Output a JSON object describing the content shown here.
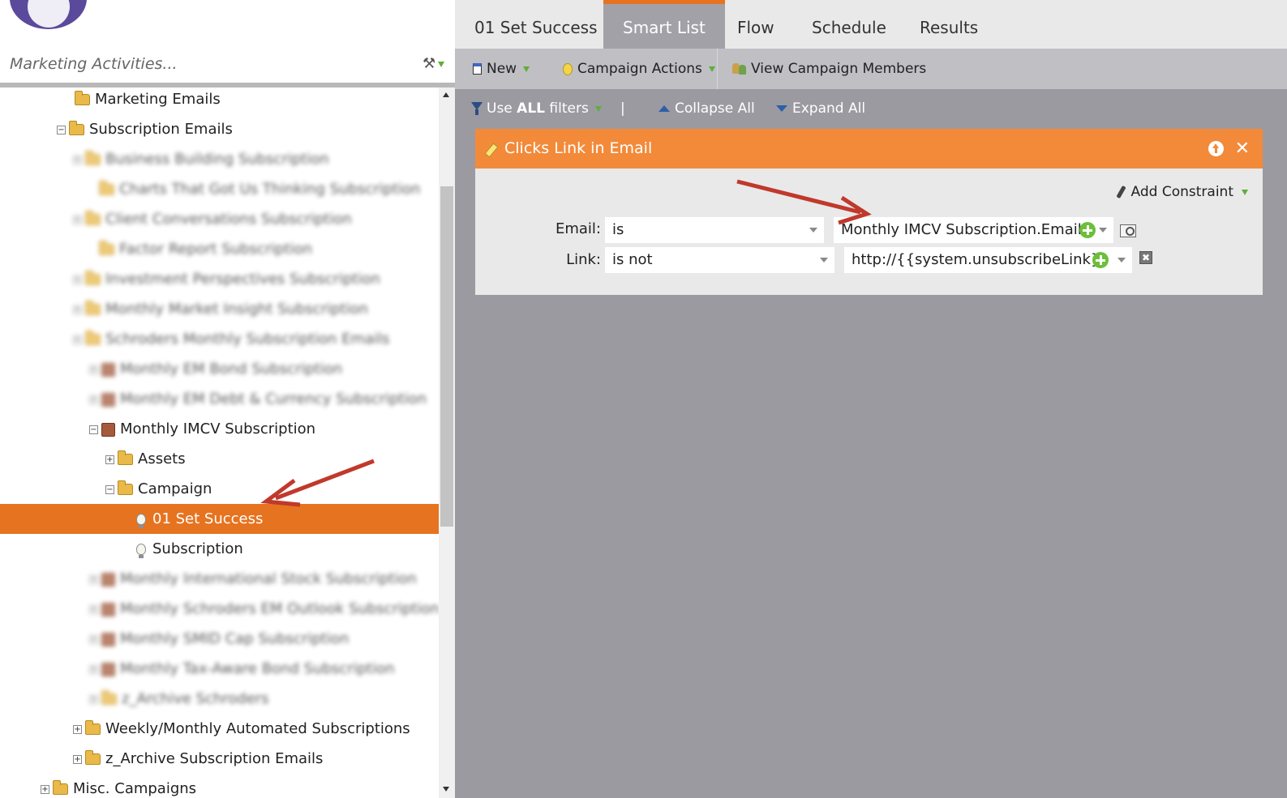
{
  "left_panel": {
    "search_placeholder": "Marketing Activities...",
    "tree": [
      {
        "label": "Marketing Emails",
        "type": "folder",
        "toggle": "",
        "blurred": false
      },
      {
        "label": "Subscription Emails",
        "type": "folder",
        "toggle": "⊟",
        "blurred": false
      },
      {
        "label": "Business Building Subscription",
        "type": "folder",
        "toggle": "⊞",
        "blurred": true
      },
      {
        "label": "Charts That Got Us Thinking Subscription",
        "type": "folder",
        "toggle": "",
        "blurred": true
      },
      {
        "label": "Client Conversations Subscription",
        "type": "folder",
        "toggle": "⊞",
        "blurred": true
      },
      {
        "label": "Factor Report Subscription",
        "type": "folder",
        "toggle": "",
        "blurred": true
      },
      {
        "label": "Investment Perspectives Subscription",
        "type": "folder",
        "toggle": "⊞",
        "blurred": true
      },
      {
        "label": "Monthly Market Insight Subscription",
        "type": "folder",
        "toggle": "⊞",
        "blurred": true
      },
      {
        "label": "Schroders Monthly Subscription Emails",
        "type": "folder",
        "toggle": "⊞",
        "blurred": true
      },
      {
        "label": "Monthly EM Bond Subscription",
        "type": "program",
        "toggle": "⊞",
        "blurred": true
      },
      {
        "label": "Monthly EM Debt & Currency Subscription",
        "type": "program",
        "toggle": "⊞",
        "blurred": true
      },
      {
        "label": "Monthly IMCV Subscription",
        "type": "program",
        "toggle": "⊟",
        "blurred": false
      },
      {
        "label": "Assets",
        "type": "folder",
        "toggle": "⊞",
        "blurred": false
      },
      {
        "label": "Campaign",
        "type": "folder",
        "toggle": "⊟",
        "blurred": false
      },
      {
        "label": "01 Set Success",
        "type": "campaign",
        "toggle": "",
        "blurred": false,
        "selected": true
      },
      {
        "label": "Subscription",
        "type": "campaign",
        "toggle": "",
        "blurred": false
      },
      {
        "label": "Monthly International Stock Subscription",
        "type": "program",
        "toggle": "⊞",
        "blurred": true
      },
      {
        "label": "Monthly Schroders EM Outlook Subscription",
        "type": "program",
        "toggle": "⊞",
        "blurred": true
      },
      {
        "label": "Monthly SMID Cap Subscription",
        "type": "program",
        "toggle": "⊞",
        "blurred": true
      },
      {
        "label": "Monthly Tax-Aware Bond Subscription",
        "type": "program",
        "toggle": "⊞",
        "blurred": true
      },
      {
        "label": "z_Archive Schroders",
        "type": "folder",
        "toggle": "⊞",
        "blurred": true
      },
      {
        "label": "Weekly/Monthly Automated Subscriptions",
        "type": "folder",
        "toggle": "⊞",
        "blurred": false
      },
      {
        "label": "z_Archive Subscription Emails",
        "type": "folder",
        "toggle": "⊞",
        "blurred": false
      },
      {
        "label": "Misc. Campaigns",
        "type": "folder",
        "toggle": "⊞",
        "blurred": false
      }
    ]
  },
  "tabs": [
    "01 Set Success",
    "Smart List",
    "Flow",
    "Schedule",
    "Results"
  ],
  "active_tab": "Smart List",
  "toolbar": {
    "new_label": "New",
    "campaign_actions_label": "Campaign Actions",
    "view_members_label": "View Campaign Members"
  },
  "filterbar": {
    "use_label_pre": "Use ",
    "use_label_bold": "ALL",
    "use_label_post": " filters",
    "divider": "|",
    "collapse_label": "Collapse All",
    "expand_label": "Expand All"
  },
  "filter": {
    "title": "Clicks Link in Email",
    "add_constraint_label": "Add Constraint",
    "rows": [
      {
        "label": "Email:",
        "operator": "is",
        "value": "Monthly IMCV Subscription.Email"
      },
      {
        "label": "Link:",
        "operator": "is not",
        "value": "http://{{system.unsubscribeLink}}"
      }
    ]
  },
  "colors": {
    "accent_orange": "#e6731f",
    "header_orange": "#f28a3a",
    "canvas_gray": "#9b9aa1",
    "annotation_arrow": "#c0392b"
  }
}
